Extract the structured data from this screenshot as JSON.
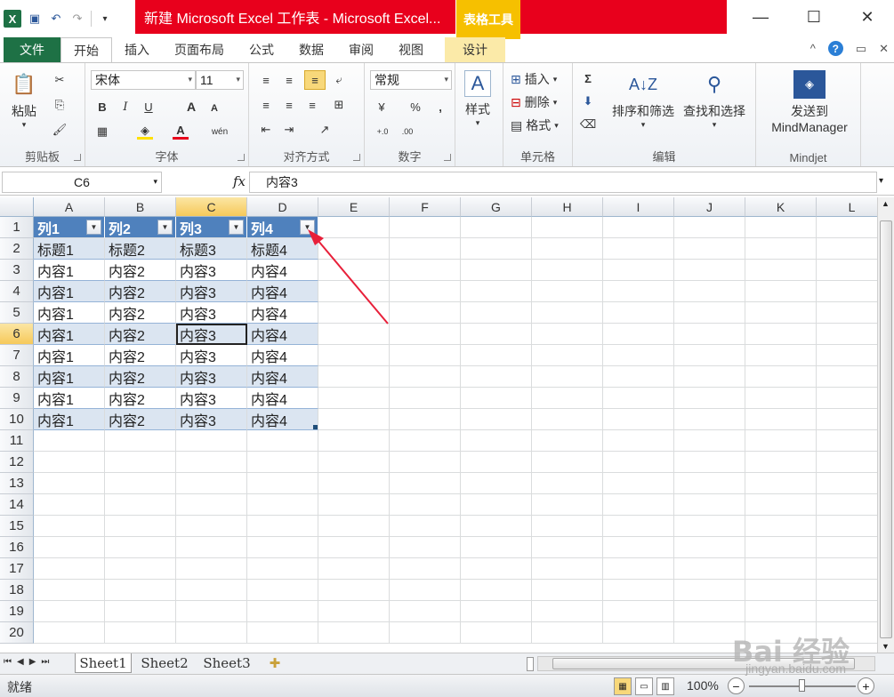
{
  "title": {
    "window_title": "新建 Microsoft Excel 工作表 - Microsoft Excel...",
    "context_tab": "表格工具"
  },
  "ribbon_tabs": [
    "文件",
    "开始",
    "插入",
    "页面布局",
    "公式",
    "数据",
    "审阅",
    "视图",
    "设计"
  ],
  "ribbon": {
    "clipboard": {
      "label": "剪贴板",
      "paste": "粘贴"
    },
    "font": {
      "label": "字体",
      "name": "宋体",
      "size": "11",
      "bold": "B",
      "italic": "I",
      "underline": "U",
      "grow": "A",
      "shrink": "A",
      "font_color": "A",
      "phonetic": "wén"
    },
    "alignment": {
      "label": "对齐方式"
    },
    "number": {
      "label": "数字",
      "format": "常规",
      "percent": "%",
      "comma": ",",
      "inc": "+.0",
      "dec": ".00"
    },
    "styles": {
      "label": "样式"
    },
    "cells": {
      "label": "单元格",
      "insert": "插入",
      "delete": "删除",
      "format": "格式"
    },
    "editing": {
      "label": "编辑",
      "sort": "排序和筛选",
      "find": "查找和选择",
      "sum": "Σ"
    },
    "mindjet": {
      "label": "Mindjet",
      "send_line1": "发送到",
      "send_line2": "MindManager"
    }
  },
  "formula_bar": {
    "name_box": "C6",
    "fx": "fx",
    "value": "内容3"
  },
  "columns": [
    "A",
    "B",
    "C",
    "D",
    "E",
    "F",
    "G",
    "H",
    "I",
    "J",
    "K",
    "L"
  ],
  "rows": [
    "1",
    "2",
    "3",
    "4",
    "5",
    "6",
    "7",
    "8",
    "9",
    "10",
    "11",
    "12",
    "13",
    "14",
    "15",
    "16",
    "17",
    "18",
    "19",
    "20"
  ],
  "table": {
    "headers": [
      "列1",
      "列2",
      "列3",
      "列4"
    ],
    "data": [
      [
        "标题1",
        "标题2",
        "标题3",
        "标题4"
      ],
      [
        "内容1",
        "内容2",
        "内容3",
        "内容4"
      ],
      [
        "内容1",
        "内容2",
        "内容3",
        "内容4"
      ],
      [
        "内容1",
        "内容2",
        "内容3",
        "内容4"
      ],
      [
        "内容1",
        "内容2",
        "内容3",
        "内容4"
      ],
      [
        "内容1",
        "内容2",
        "内容3",
        "内容4"
      ],
      [
        "内容1",
        "内容2",
        "内容3",
        "内容4"
      ],
      [
        "内容1",
        "内容2",
        "内容3",
        "内容4"
      ],
      [
        "内容1",
        "内容2",
        "内容3",
        "内容4"
      ]
    ]
  },
  "sheets": [
    "Sheet1",
    "Sheet2",
    "Sheet3"
  ],
  "status": {
    "ready": "就绪",
    "zoom": "100%"
  },
  "watermark": {
    "brand": "Bai 经验",
    "url": "jingyan.baidu.com"
  },
  "colors": {
    "table_header": "#4f81bd",
    "band": "#dbe5f1",
    "file_tab": "#1e7145",
    "title_red": "#e8001c",
    "context": "#f6c000"
  }
}
